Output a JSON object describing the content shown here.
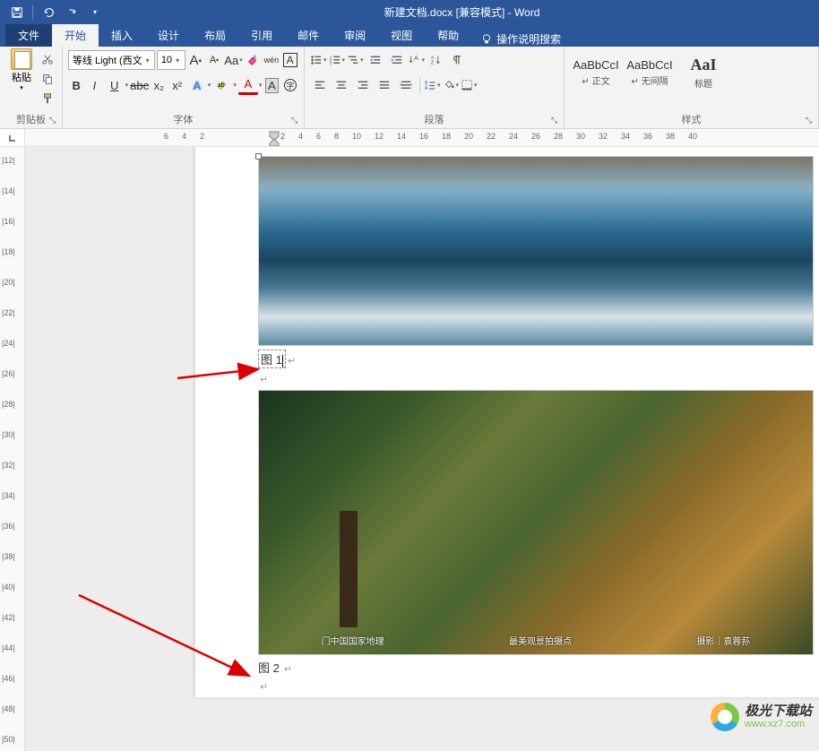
{
  "titlebar": {
    "title": "新建文档.docx [兼容模式] - Word"
  },
  "tabs": {
    "file": "文件",
    "home": "开始",
    "insert": "插入",
    "design": "设计",
    "layout": "布局",
    "references": "引用",
    "mailings": "邮件",
    "review": "审阅",
    "view": "视图",
    "help": "帮助",
    "tellme": "操作说明搜索"
  },
  "ribbon": {
    "clipboard": {
      "label": "剪贴板",
      "paste": "粘贴"
    },
    "font": {
      "label": "字体",
      "name": "等线 Light (西文",
      "size": "10",
      "grow": "A",
      "shrink": "A",
      "case": "Aa",
      "phonetic": "wén",
      "charborder": "A",
      "bold": "B",
      "italic": "I",
      "underline": "U",
      "strike": "abc",
      "sub": "x₂",
      "sup": "x²"
    },
    "paragraph": {
      "label": "段落"
    },
    "styles": {
      "label": "样式",
      "items": [
        {
          "preview": "AaBbCcI",
          "name": "↵ 正文"
        },
        {
          "preview": "AaBbCcI",
          "name": "↵ 无间隔"
        },
        {
          "preview": "AaI",
          "name": "标题"
        }
      ]
    }
  },
  "ruler_h": [
    6,
    4,
    2,
    2,
    4,
    6,
    8,
    10,
    12,
    14,
    16,
    18,
    20,
    22,
    24,
    26,
    28,
    30,
    32,
    34,
    36,
    38,
    40
  ],
  "ruler_v": [
    "|12|",
    "|14|",
    "|16|",
    "|18|",
    "|20|",
    "|22|",
    "|24|",
    "|26|",
    "|28|",
    "|30|",
    "|32|",
    "|34|",
    "|36|",
    "|38|",
    "|40|",
    "|42|",
    "|44|",
    "|46|",
    "|48|",
    "|50|"
  ],
  "doc": {
    "caption1": "图 1",
    "caption2": "图 2",
    "credits": [
      "门中国国家地理",
      "最美观景拍摄点",
      "摄影｜袁蓉荪"
    ]
  },
  "watermark": {
    "cn": "极光下载站",
    "en": "www.xz7.com"
  }
}
